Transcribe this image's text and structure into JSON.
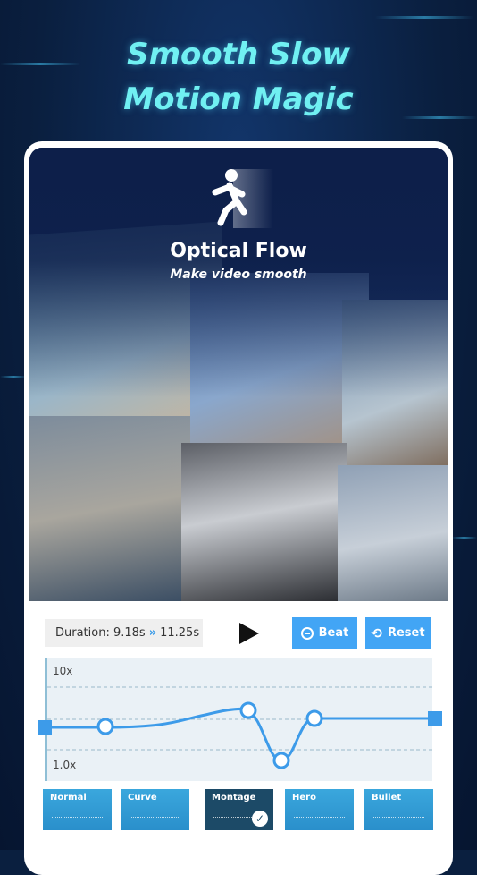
{
  "headline": {
    "line1": "Smooth Slow",
    "line2": "Motion Magic"
  },
  "feature": {
    "title": "Optical Flow",
    "subtitle": "Make video smooth",
    "icon": "running-person-icon"
  },
  "toolbar": {
    "duration_label": "Duration: 9.18s",
    "arrow": "»",
    "new_duration": "11.25s",
    "play_icon": "play-icon",
    "beat_label": "Beat",
    "reset_label": "Reset"
  },
  "graph": {
    "max_label": "10x",
    "min_label": "1.0x"
  },
  "presets": [
    {
      "label": "Normal",
      "selected": false
    },
    {
      "label": "Curve",
      "selected": false
    },
    {
      "label": "Montage",
      "selected": true
    },
    {
      "label": "Hero",
      "selected": false
    },
    {
      "label": "Bullet",
      "selected": false
    }
  ],
  "colors": {
    "accent": "#42a5f5",
    "headline": "#70f0f2",
    "background": "#0a1f3f",
    "selected_preset": "#1c4a67"
  }
}
